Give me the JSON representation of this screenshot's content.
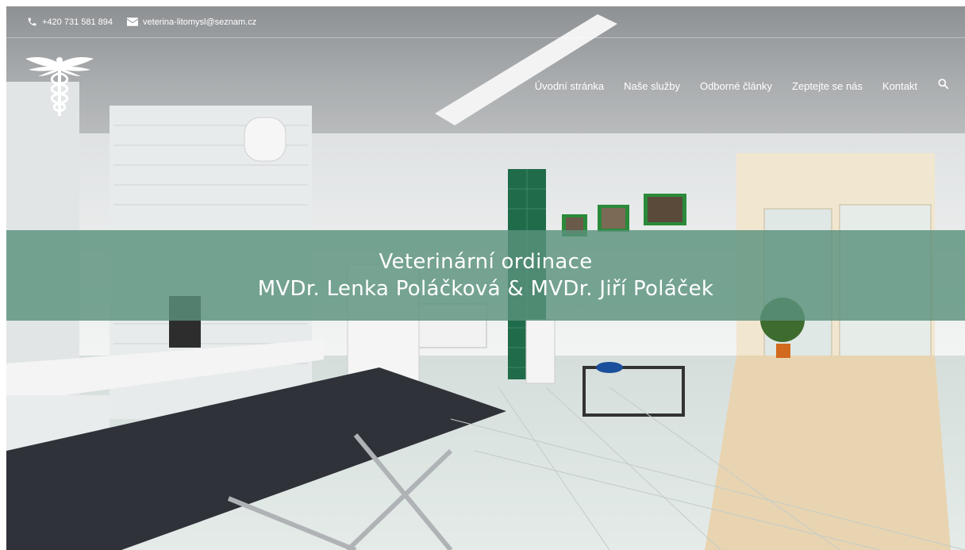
{
  "topbar": {
    "phone": "+420 731 581 894",
    "email": "veterina-litomysl@seznam.cz"
  },
  "nav": {
    "items": [
      {
        "label": "Úvodní stránka"
      },
      {
        "label": "Naše služby"
      },
      {
        "label": "Odborné články"
      },
      {
        "label": "Zeptejte se nás"
      },
      {
        "label": "Kontakt"
      }
    ]
  },
  "hero": {
    "line1": "Veterinární ordinace",
    "line2": "MVDr. Lenka Poláčková & MVDr. Jiří Poláček"
  },
  "colors": {
    "banner": "#5a917d",
    "tile_green": "#1f6b4a",
    "picture_frame": "#2a8a3a"
  }
}
